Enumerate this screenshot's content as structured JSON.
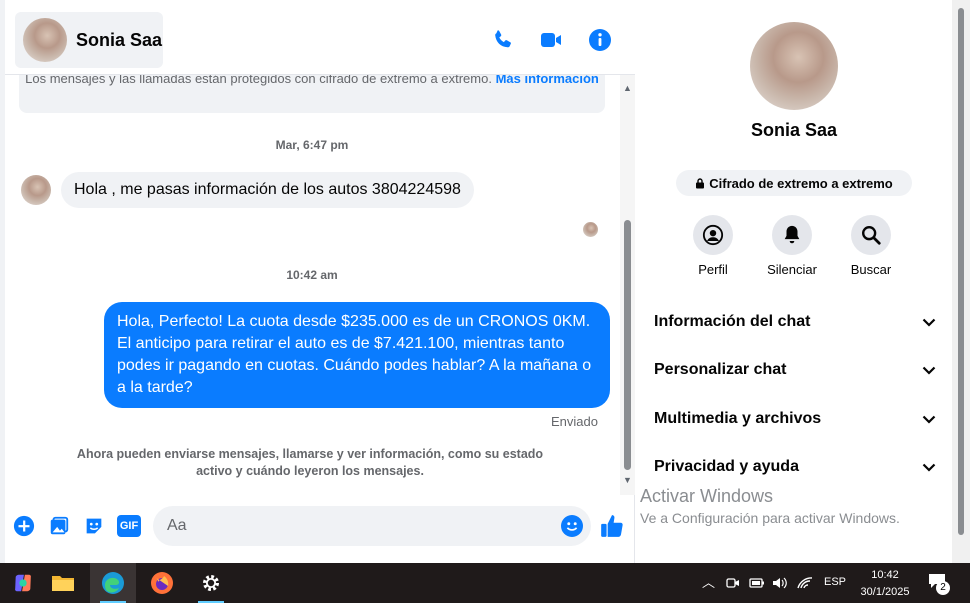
{
  "header": {
    "contact_name": "Sonia Saa",
    "icons": [
      "phone-icon",
      "video-icon",
      "info-icon"
    ]
  },
  "conversation": {
    "encryption_notice": "Los mensajes y las llamadas están protegidos con cifrado de extremo a extremo.",
    "encryption_more": "Más información",
    "timestamp1": "Mar, 6:47 pm",
    "incoming_message": "Hola , me pasas información de los autos 3804224598",
    "timestamp2": "10:42 am",
    "outgoing_message": "Hola, Perfecto! La cuota desde $235.000 es de un CRONOS 0KM. El anticipo para retirar el auto es de $7.421.100, mientras tanto podes ir pagando en cuotas. Cuándo podes hablar? A la mañana o a la tarde?",
    "sent_status": "Enviado",
    "notice": "Ahora pueden enviarse mensajes, llamarse y ver información, como su estado activo y cuándo leyeron los mensajes."
  },
  "composer": {
    "placeholder": "Aa",
    "gif_label": "GIF"
  },
  "sidebar": {
    "name": "Sonia Saa",
    "e2e_label": "Cifrado de extremo a extremo",
    "actions": [
      {
        "label": "Perfil",
        "icon": "profile-icon"
      },
      {
        "label": "Silenciar",
        "icon": "bell-icon"
      },
      {
        "label": "Buscar",
        "icon": "search-icon"
      }
    ],
    "sections": [
      {
        "label": "Información del chat"
      },
      {
        "label": "Personalizar chat"
      },
      {
        "label": "Multimedia y archivos"
      },
      {
        "label": "Privacidad y ayuda"
      }
    ]
  },
  "watermark": {
    "line1": "Activar Windows",
    "line2": "Ve a Configuración para activar Windows."
  },
  "taskbar": {
    "language": "ESP",
    "time": "10:42",
    "date": "30/1/2025",
    "notification_count": "2"
  },
  "colors": {
    "accent": "#0a7cff",
    "bubble_in": "#f0f2f5",
    "taskbar": "#1f1a1a"
  }
}
